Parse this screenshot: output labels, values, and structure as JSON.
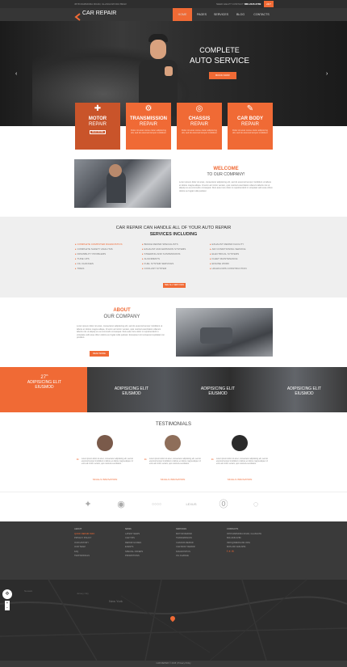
{
  "topbar": {
    "address": "4578 MARMORA ROAD, GLASGOW D04 89GR",
    "phone_label": "NEED HELP? CONTACT US:",
    "phone": "800-2345-6789",
    "badge": "24/7"
  },
  "header": {
    "logo": "CAR REPAIR",
    "nav": [
      "HOME",
      "PAGES",
      "SERVICES",
      "BLOG",
      "CONTACTS"
    ]
  },
  "hero": {
    "title1": "COMPLETE",
    "title2": "AUTO SERVICE",
    "button": "BOOK NOW!"
  },
  "tiles": [
    {
      "l1": "MOTOR",
      "l2": "REPAIR",
      "text": "Lorem ipsum dolor sit amet conse ctetur adipisicing elit, sed do eiusmod tempor",
      "btn": "READ MORE",
      "icon": "✚"
    },
    {
      "l1": "TRANSMISSION",
      "l2": "REPAIR",
      "text": "Dolor sit amet conse ctetur adipisicing elit, sed do eiusmod tempor incididunt",
      "btn": "READ MORE",
      "icon": "⚙"
    },
    {
      "l1": "CHASSIS",
      "l2": "REPAIR",
      "text": "Dolor sit amet conse ctetur adipisicing elit, sed do eiusmod tempor incididunt",
      "btn": "READ MORE",
      "icon": "◎"
    },
    {
      "l1": "CAR BODY",
      "l2": "REPAIR",
      "text": "Dolor sit amet conse ctetur adipisicing elit, sed do eiusmod tempor incididunt",
      "btn": "READ MORE",
      "icon": "✎"
    }
  ],
  "welcome": {
    "title": "WELCOME",
    "subtitle": "TO OUR COMPANY!",
    "text": "Lorem ipsum dolor sit amet, consectetur adipisicing elit, sed do eiusmod tempor incididunt ut labore et dolore magna aliqua. Ut enim ad minim veniam, quis nostrud exercitation ullamco laboris nisi ut aliquip ex ea commodo consequat. Duis aute irure dolor in reprehenderit in voluptate velit esse cillum dolore eu fugiat nulla pariatur."
  },
  "services": {
    "title1": "CAR REPAIR CAN HANDLE ALL OF YOUR AUTO REPAIR",
    "title2": "SERVICES INCLUDING",
    "button": "SEE ALL SERVICES",
    "col1": [
      "COMPLETE COMPUTER DIAGNOSTICS",
      "COMPLETE SAFETY ANALYSIS",
      "DRIVABILITY PROBLEMS",
      "TUNE UPS",
      "OIL CHANGES",
      "TIRES"
    ],
    "col2": [
      "BRAKE REPAIR SPECIALISTS",
      "EXHAUST AND EMISSION SYSTEMS",
      "STEERING AND SUSPENSIONS",
      "ALIGNMENTS",
      "FUEL SYSTEM SERVICES",
      "COOLANT SYSTEM"
    ],
    "col3": [
      "EXHAUST REPAIR FACILITY",
      "AIR CONDITIONING SERVICE",
      "ELECTRICAL SYSTEMS",
      "FLEET MAINTENANCE",
      "ENGINE WORK",
      "HIGHFLOWS CONSTRUCTION"
    ]
  },
  "about": {
    "title": "ABOUT",
    "subtitle": "OUR COMPANY",
    "text": "Lorem ipsum dolor sit amet, consectetur adipisicing elit, sed do eiusmod tempor incididunt ut labore et dolore magna aliqua. Ut enim ad minim veniam, quis nostrud exercitation ullamco laboris nisi ut aliquip ex ea commodo consequat. Duis aute irure dolor in reprehenderit in voluptate velit esse cillum dolore eu fugiat nulla pariatur. Excepteur sint occaecat cupidatat non proident.",
    "button": "READ MORE"
  },
  "band": [
    {
      "num": "27",
      "sup": "th",
      "l1": "ADIPISICING ELIT",
      "l2": "EIUSMOD"
    },
    {
      "num": "",
      "sup": "",
      "l1": "ADIPISICING ELIT",
      "l2": "EIUSMOD"
    },
    {
      "num": "",
      "sup": "",
      "l1": "ADIPISICING ELIT",
      "l2": "EIUSMOD"
    },
    {
      "num": "",
      "sup": "",
      "l1": "ADIPISICING ELIT",
      "l2": "EIUSMOD"
    }
  ],
  "testimonials": {
    "title": "TESTIMONIALS",
    "items": [
      {
        "quote": "Lorem ipsum dolor sit amet, consectetur adipisicing elit, sed do eiusmod tempor incididunt ut labore et dolore magna aliqua. Ut enim ad minim veniam, quis nostrud exercitation.",
        "name": "SKULLS INNOVATION"
      },
      {
        "quote": "Lorem ipsum dolor sit amet, consectetur adipisicing elit, sed do eiusmod tempor incididunt ut labore et dolore magna aliqua. Ut enim ad minim veniam, quis nostrud exercitation.",
        "name": "SKULLS INNOVATION"
      },
      {
        "quote": "Lorem ipsum dolor sit amet, consectetur adipisicing elit, sed do eiusmod tempor incididunt ut labore et dolore magna aliqua. Ut enim ad minim veniam, quis nostrud exercitation.",
        "name": "SKULLS INNOVATION"
      }
    ]
  },
  "logos": [
    "✦",
    "◉",
    "○○○○",
    "LEXUS",
    "⓪",
    "◌"
  ],
  "footer": {
    "about": {
      "title": "ABOUT",
      "items": [
        "QUICK REPAIR INFO",
        "PRIVACY POLICY",
        "OUR HISTORY",
        "OUR TEAM",
        "FAQ",
        "TESTIMONIALS"
      ]
    },
    "news": {
      "title": "NEWS",
      "items": [
        "LATEST NEWS",
        "CAR TIPS",
        "REPAIR GUIDES",
        "EVENTS",
        "SPECIAL OFFERS",
        "PROMOTIONS"
      ]
    },
    "services": {
      "title": "SERVICES",
      "items": [
        "MOTOR REPAIR",
        "TRANSMISSION",
        "CHASSIS REPAIR",
        "CAR BODY REPAIR",
        "DIAGNOSTICS",
        "OIL CHANGE"
      ]
    },
    "contacts": {
      "title": "CONTACTS",
      "items": [
        "4578 MARMORA ROAD, GLASGOW",
        "800-2345-6789",
        "INFO@DEMOLINK.ORG",
        "MON-FRI 9AM-6PM"
      ]
    }
  },
  "map": {
    "cities": [
      "New York",
      "Jersey City",
      "Newark"
    ]
  },
  "copyright": "CAR REPAIR © 2015 | Privacy Policy"
}
